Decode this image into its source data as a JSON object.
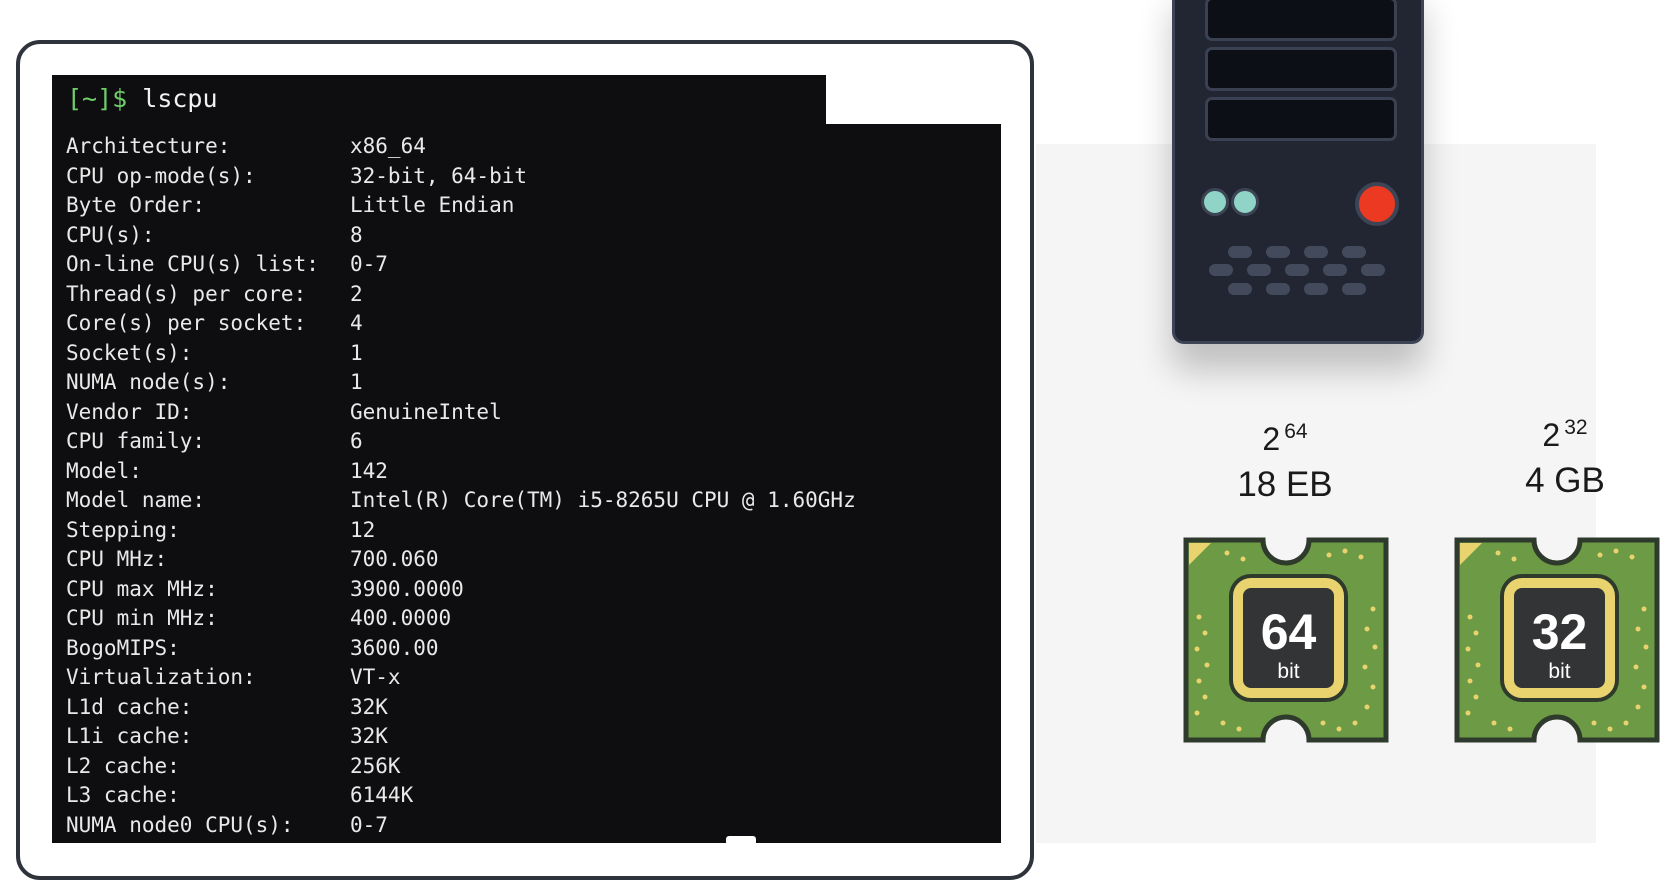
{
  "terminal": {
    "prompt": "[~]$",
    "command": "lscpu",
    "rows": [
      {
        "key": "Architecture:",
        "value": "x86_64"
      },
      {
        "key": "CPU op-mode(s):",
        "value": "32-bit, 64-bit"
      },
      {
        "key": "Byte Order:",
        "value": "Little Endian"
      },
      {
        "key": "CPU(s):",
        "value": "8"
      },
      {
        "key": "On-line CPU(s) list:",
        "value": "0-7"
      },
      {
        "key": "Thread(s) per core:",
        "value": "2"
      },
      {
        "key": "Core(s) per socket:",
        "value": "4"
      },
      {
        "key": "Socket(s):",
        "value": "1"
      },
      {
        "key": "NUMA node(s):",
        "value": "1"
      },
      {
        "key": "Vendor ID:",
        "value": "GenuineIntel"
      },
      {
        "key": "CPU family:",
        "value": "6"
      },
      {
        "key": "Model:",
        "value": "142"
      },
      {
        "key": "Model name:",
        "value": "Intel(R) Core(TM) i5-8265U CPU @ 1.60GHz"
      },
      {
        "key": "Stepping:",
        "value": "12"
      },
      {
        "key": "CPU MHz:",
        "value": "700.060"
      },
      {
        "key": "CPU max MHz:",
        "value": "3900.0000"
      },
      {
        "key": "CPU min MHz:",
        "value": "400.0000"
      },
      {
        "key": "BogoMIPS:",
        "value": "3600.00"
      },
      {
        "key": "Virtualization:",
        "value": "VT-x"
      },
      {
        "key": "L1d cache:",
        "value": "32K"
      },
      {
        "key": "L1i cache:",
        "value": "32K"
      },
      {
        "key": "L2 cache:",
        "value": "256K"
      },
      {
        "key": "L3 cache:",
        "value": "6144K"
      },
      {
        "key": "NUMA node0 CPU(s):",
        "value": "0-7"
      }
    ]
  },
  "memory": [
    {
      "base": "2",
      "exponent": "64",
      "size": "18 EB",
      "chip_number": "64",
      "chip_unit": "bit"
    },
    {
      "base": "2",
      "exponent": "32",
      "size": "4 GB",
      "chip_number": "32",
      "chip_unit": "bit"
    }
  ],
  "colors": {
    "terminal_bg": "#0e0e10",
    "prompt_green": "#6fce6a",
    "chip_green": "#6d9a44",
    "chip_gold": "#e8d36f",
    "power_red": "#ec3a22",
    "server_body": "#212632"
  },
  "icons": [
    "server-tower-icon",
    "cpu-chip-icon"
  ]
}
